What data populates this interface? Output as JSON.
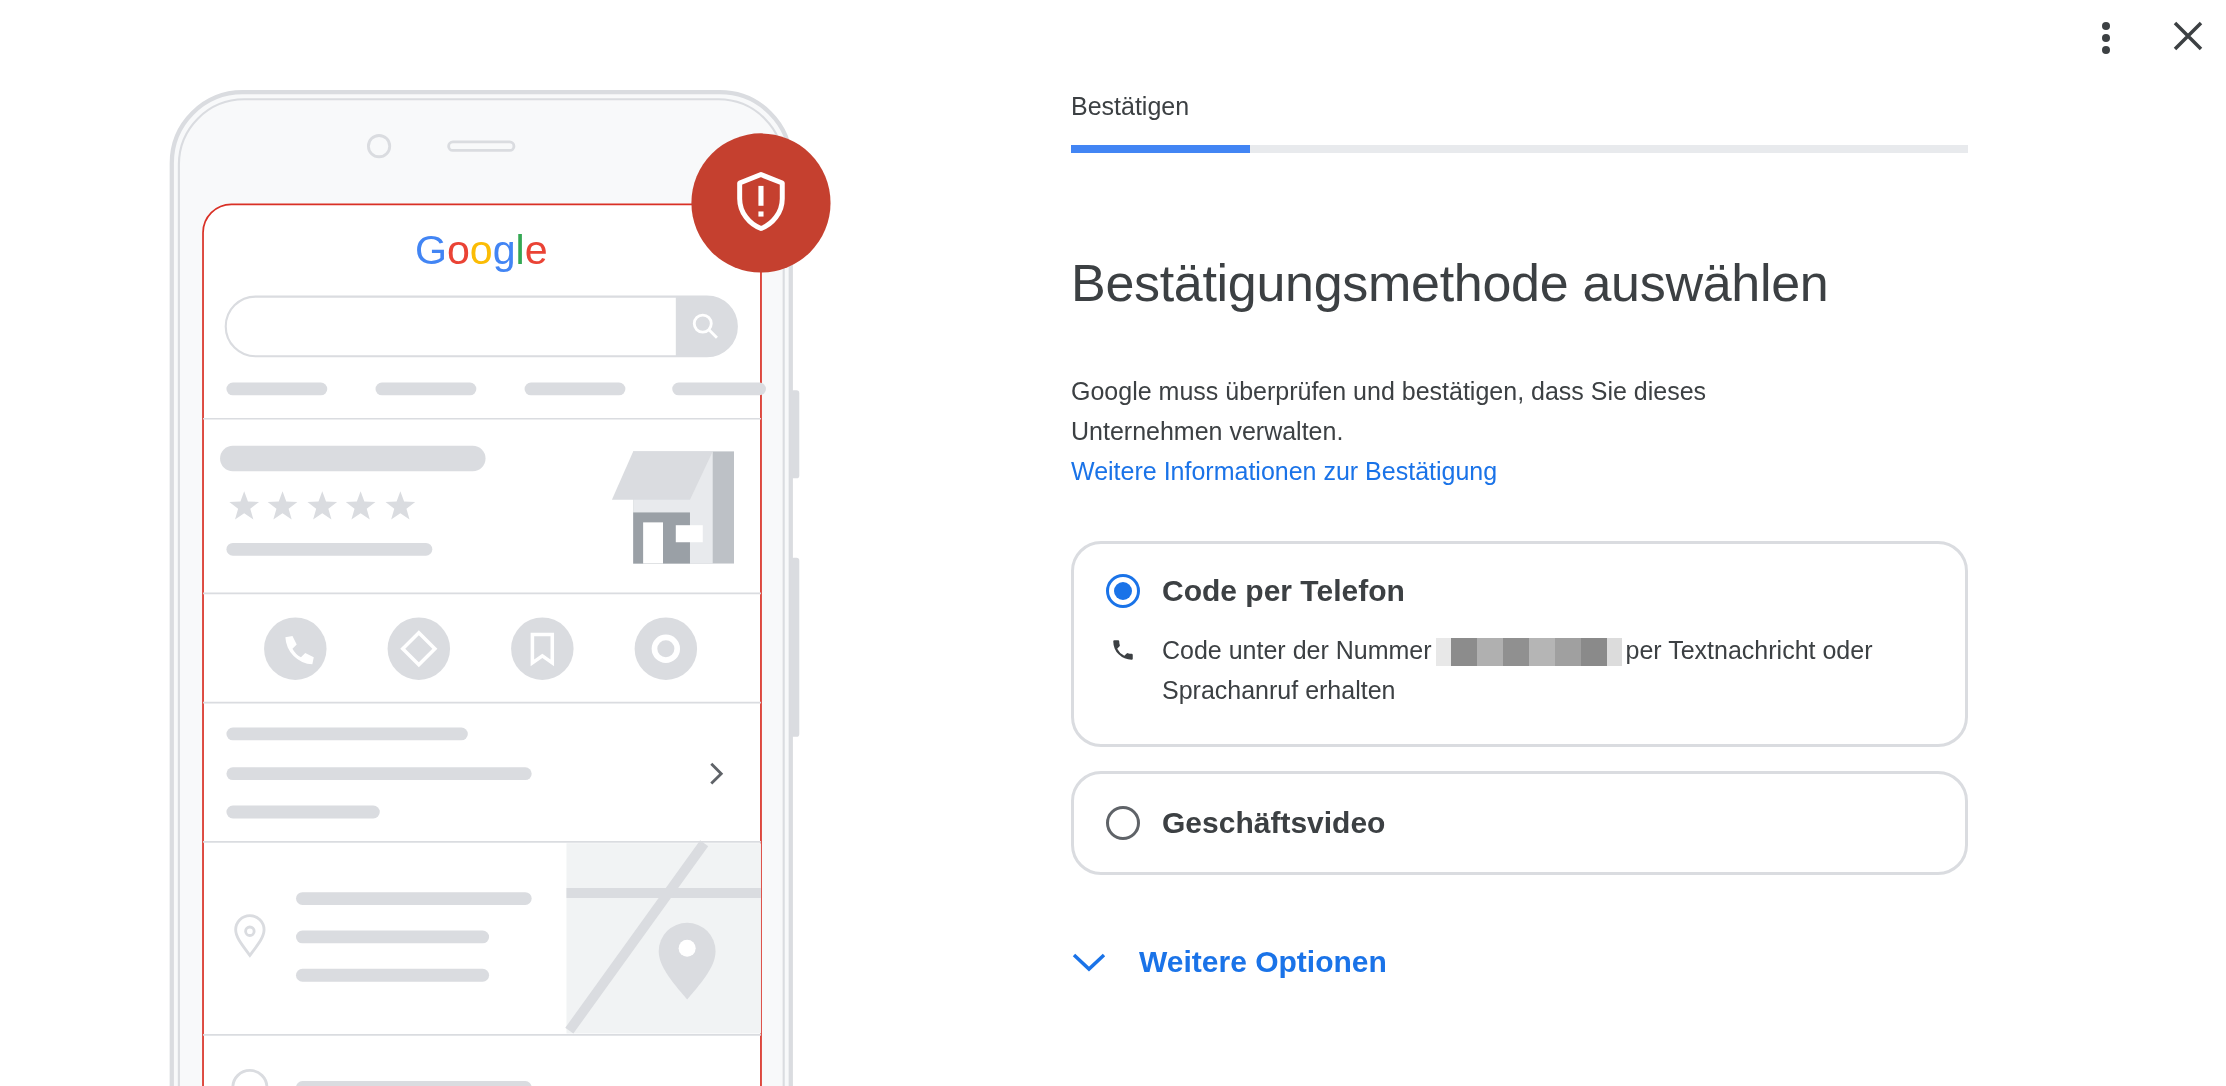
{
  "illustration": {
    "logo": "Google"
  },
  "stepper": {
    "label": "Bestätigen",
    "level": 0.2
  },
  "title": "Bestätigungsmethode auswählen",
  "description": "Google muss überprüfen und bestätigen, dass Sie dieses Unternehmen verwalten.",
  "link": "Weitere Informationen zur Bestätigung",
  "options": [
    {
      "label": "Code per Telefon",
      "selected": true,
      "detail_before": "Code unter der Nummer",
      "detail_after": "per Textnachricht oder Sprachanruf erhalten"
    },
    {
      "label": "Geschäftsvideo",
      "selected": false
    }
  ],
  "more_options": {
    "label": "Weitere Optionen",
    "expanded": false
  }
}
